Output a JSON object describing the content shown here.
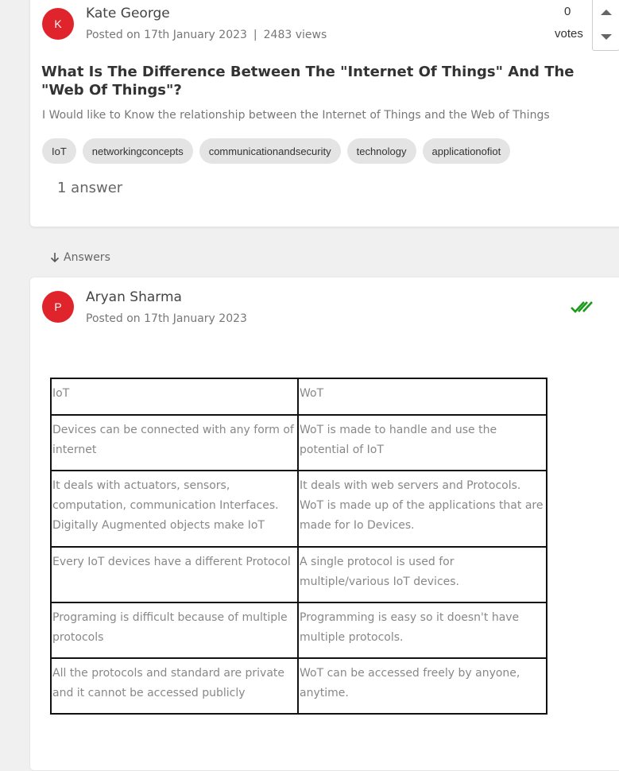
{
  "question": {
    "avatar_initial": "K",
    "author": "Kate George",
    "posted": "Posted on 17th January 2023",
    "separator": "|",
    "views": "2483 views",
    "votes_count": "0",
    "votes_label": "votes",
    "title": "What Is The Difference Between The \"Internet Of Things\" And The \"Web Of Things\"?",
    "description": "I Would like to Know the relationship between the  Internet of Things and the Web of Things",
    "tags": [
      "IoT",
      "networkingconcepts",
      "communicationandsecurity",
      "technology",
      "applicationofiot"
    ],
    "answer_count": "1 answer"
  },
  "answers_header": "Answers",
  "answer": {
    "avatar_initial": "P",
    "author": "Aryan Sharma",
    "posted": "Posted on 17th January 2023",
    "accepted_color": "#1a9a1a",
    "table": [
      [
        "IoT",
        "WoT"
      ],
      [
        "Devices can be connected with any form of internet",
        "WoT is made to handle and use the potential of IoT"
      ],
      [
        "It deals with actuators, sensors, computation, communication Interfaces. Digitally Augmented objects make IoT",
        "It deals with web servers and Protocols. WoT is made up of the applications that are made for Io Devices."
      ],
      [
        "Every IoT devices have a different Protocol",
        "A single protocol is used for multiple/various IoT devices."
      ],
      [
        "Programing is difficult because of multiple protocols",
        "Programming is easy so it doesn't have multiple protocols."
      ],
      [
        "All the protocols and standard are private and it cannot be accessed publicly",
        "WoT can be accessed freely by anyone, anytime."
      ]
    ]
  },
  "colors": {
    "accent": "#e0242c",
    "accepted": "#1a9a1a"
  }
}
